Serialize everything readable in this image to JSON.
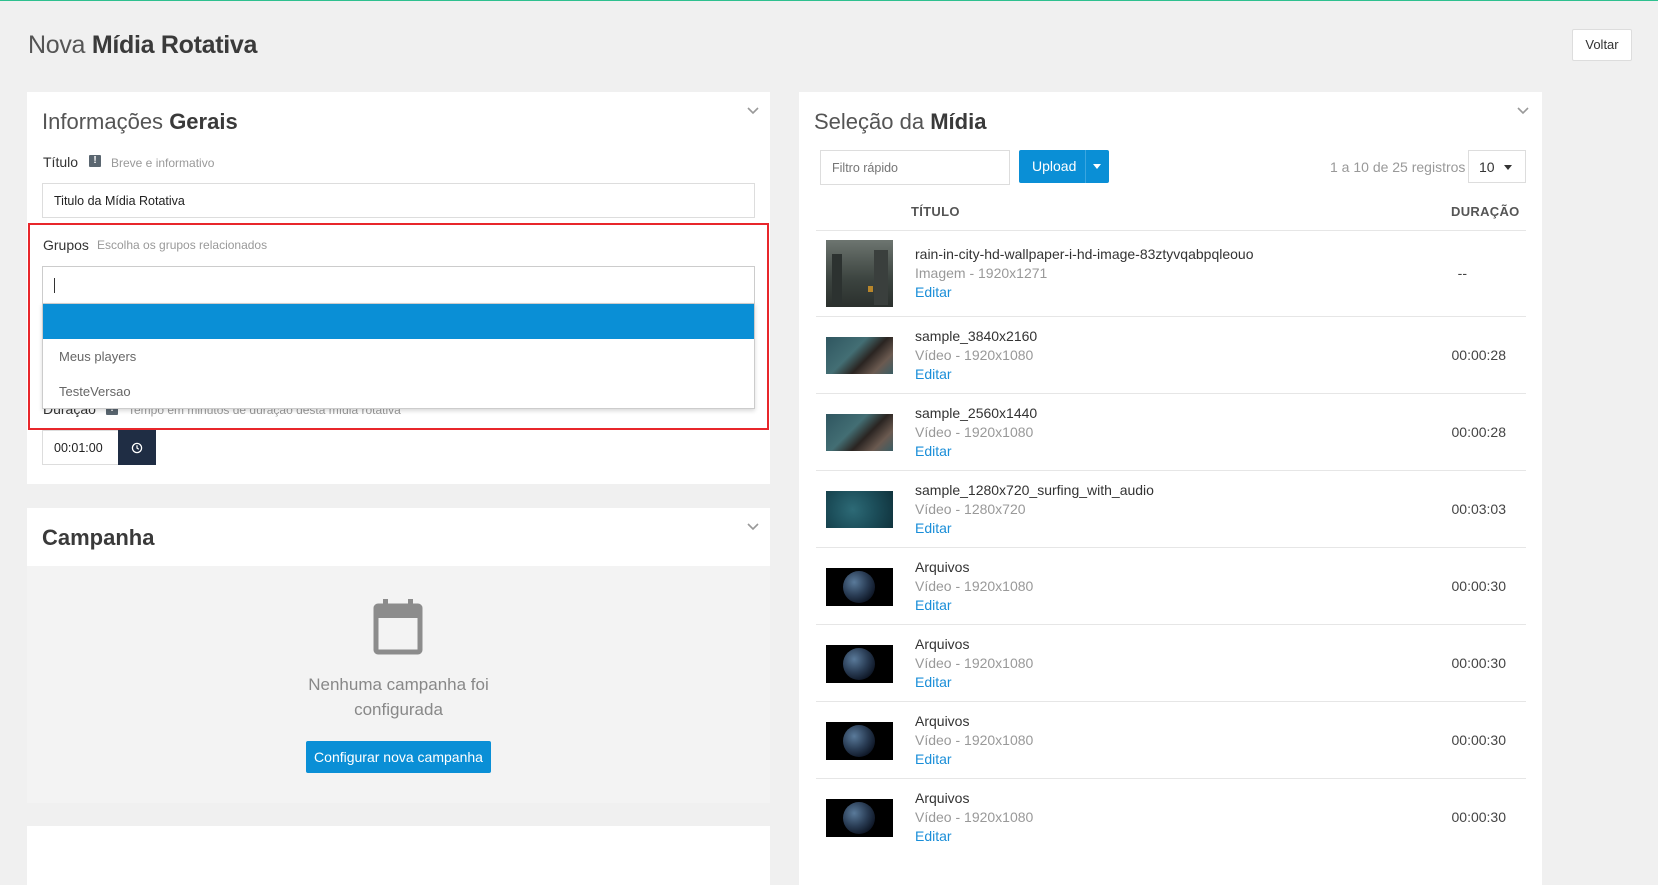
{
  "header": {
    "title_prefix": "Nova",
    "title_bold": "Mídia Rotativa",
    "back_label": "Voltar"
  },
  "general": {
    "title_prefix": "Informações",
    "title_bold": "Gerais",
    "titulo_label": "Título",
    "titulo_hint": "Breve e informativo",
    "titulo_value": "Titulo da Mídia Rotativa",
    "grupos_label": "Grupos",
    "grupos_hint": "Escolha os grupos relacionados",
    "grupos_options": [
      "Meus players",
      "TesteVersao"
    ],
    "duracao_label": "Duração",
    "duracao_hint": "Tempo em minutos de duração desta mídia rotativa",
    "duracao_value": "00:01:00"
  },
  "campaign": {
    "title": "Campanha",
    "empty_line1": "Nenhuma campanha foi",
    "empty_line2": "configurada",
    "button_label": "Configurar nova campanha"
  },
  "media": {
    "title_prefix": "Seleção da",
    "title_bold": "Mídia",
    "filter_placeholder": "Filtro rápido",
    "upload_label": "Upload",
    "records_info": "1 a 10 de 25 registros",
    "page_size": "10",
    "col_title": "TÍTULO",
    "col_duration": "DURAÇÃO",
    "edit_label": "Editar",
    "rows": [
      {
        "title": "rain-in-city-hd-wallpaper-i-hd-image-83ztyvqabpqleouo",
        "meta": "Imagem - 1920x1271",
        "duration": "--",
        "thumb": "city"
      },
      {
        "title": "sample_3840x2160",
        "meta": "Vídeo - 1920x1080",
        "duration": "00:00:28",
        "thumb": "coast"
      },
      {
        "title": "sample_2560x1440",
        "meta": "Vídeo - 1920x1080",
        "duration": "00:00:28",
        "thumb": "coast"
      },
      {
        "title": "sample_1280x720_surfing_with_audio",
        "meta": "Vídeo - 1280x720",
        "duration": "00:03:03",
        "thumb": "water"
      },
      {
        "title": "Arquivos",
        "meta": "Vídeo - 1920x1080",
        "duration": "00:00:30",
        "thumb": "earth"
      },
      {
        "title": "Arquivos",
        "meta": "Vídeo - 1920x1080",
        "duration": "00:00:30",
        "thumb": "earth"
      },
      {
        "title": "Arquivos",
        "meta": "Vídeo - 1920x1080",
        "duration": "00:00:30",
        "thumb": "earth"
      },
      {
        "title": "Arquivos",
        "meta": "Vídeo - 1920x1080",
        "duration": "00:00:30",
        "thumb": "earth"
      }
    ]
  },
  "colors": {
    "accent": "#0a8fd6",
    "highlight": "#e8262b",
    "dark_button": "#1f2d44"
  }
}
